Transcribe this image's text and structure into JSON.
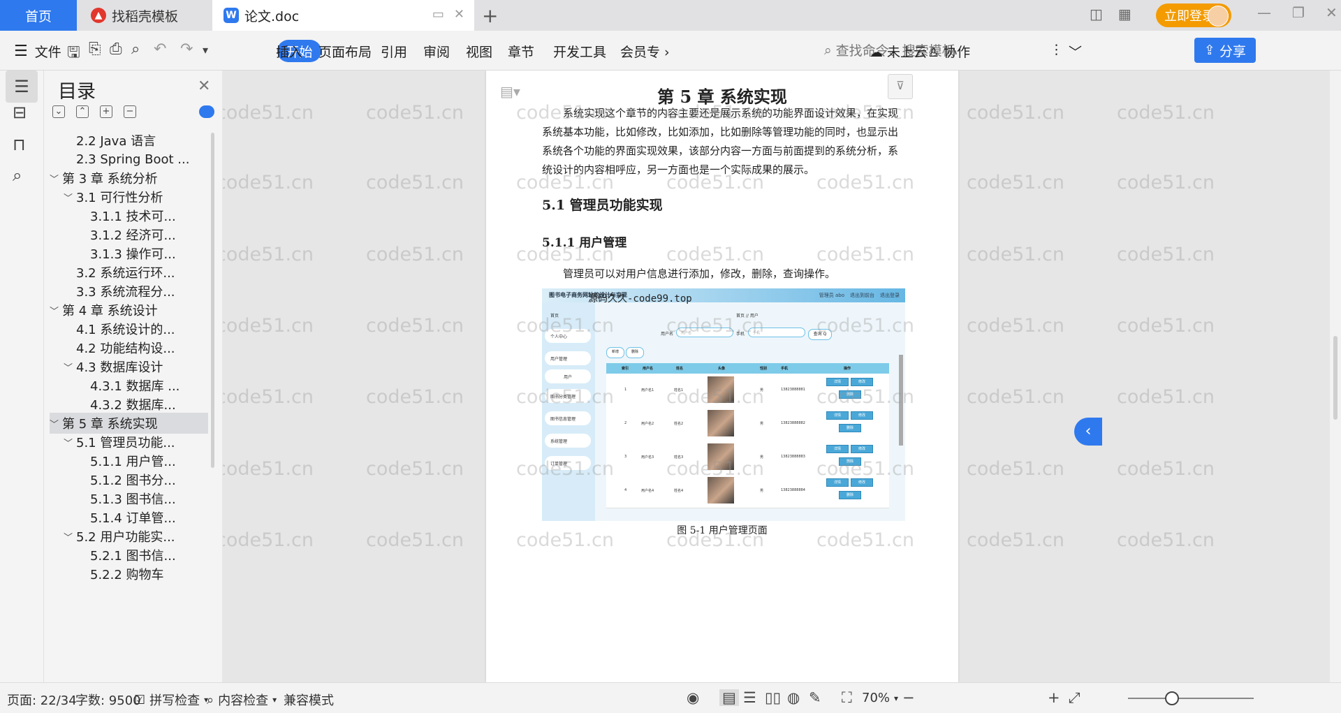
{
  "tabs": {
    "home": "首页",
    "template": "找稻壳模板",
    "doc": "论文.doc",
    "login": "立即登录"
  },
  "ribbon": {
    "file": "文件",
    "start": "开始",
    "insert": "插入",
    "layout": "页面布局",
    "reference": "引用",
    "review": "审阅",
    "view": "视图",
    "chapter": "章节",
    "devtools": "开发工具",
    "member": "会员专",
    "search_placeholder": "查找命令、搜索模板",
    "cloud": "未上云",
    "collab": "协作",
    "share": "分享"
  },
  "toc": {
    "title": "目录",
    "items": [
      {
        "label": "2.2 Java 语言",
        "level": 2,
        "chev": ""
      },
      {
        "label": "2.3 Spring Boot ...",
        "level": 2,
        "chev": ""
      },
      {
        "label": "第 3 章  系统分析",
        "level": 1,
        "chev": "﹀"
      },
      {
        "label": "3.1 可行性分析",
        "level": 2,
        "chev": "﹀"
      },
      {
        "label": "3.1.1 技术可...",
        "level": 3,
        "chev": ""
      },
      {
        "label": "3.1.2 经济可...",
        "level": 3,
        "chev": ""
      },
      {
        "label": "3.1.3 操作可...",
        "level": 3,
        "chev": ""
      },
      {
        "label": "3.2 系统运行环...",
        "level": 2,
        "chev": ""
      },
      {
        "label": "3.3 系统流程分...",
        "level": 2,
        "chev": ""
      },
      {
        "label": "第 4 章  系统设计",
        "level": 1,
        "chev": "﹀"
      },
      {
        "label": "4.1  系统设计的...",
        "level": 2,
        "chev": ""
      },
      {
        "label": "4.2  功能结构设...",
        "level": 2,
        "chev": ""
      },
      {
        "label": "4.3  数据库设计",
        "level": 2,
        "chev": "﹀"
      },
      {
        "label": "4.3.1  数据库 ...",
        "level": 3,
        "chev": ""
      },
      {
        "label": "4.3.2  数据库...",
        "level": 3,
        "chev": ""
      },
      {
        "label": "第 5 章  系统实现",
        "level": 1,
        "chev": "﹀"
      },
      {
        "label": "5.1 管理员功能...",
        "level": 2,
        "chev": "﹀"
      },
      {
        "label": "5.1.1  用户管...",
        "level": 3,
        "chev": ""
      },
      {
        "label": "5.1.2  图书分...",
        "level": 3,
        "chev": ""
      },
      {
        "label": "5.1.3  图书信...",
        "level": 3,
        "chev": ""
      },
      {
        "label": "5.1.4  订单管...",
        "level": 3,
        "chev": ""
      },
      {
        "label": "5.2  用户功能实...",
        "level": 2,
        "chev": "﹀"
      },
      {
        "label": "5.2.1  图书信...",
        "level": 3,
        "chev": ""
      },
      {
        "label": "5.2.2  购物车",
        "level": 3,
        "chev": ""
      }
    ]
  },
  "doc": {
    "chapter_title": "第 5 章  系统实现",
    "intro": "系统实现这个章节的内容主要还是展示系统的功能界面设计效果，在实现系统基本功能，比如修改，比如添加，比如删除等管理功能的同时，也显示出系统各个功能的界面实现效果，该部分内容一方面与前面提到的系统分析，系统设计的内容相呼应，另一方面也是一个实际成果的展示。",
    "sec51": "5.1 管理员功能实现",
    "sec511": "5.1.1  用户管理",
    "admin_line": "管理员可以对用户信息进行添加，修改，删除，查询操作。",
    "caption": "图 5-1  用户管理页面",
    "screenshot": {
      "title": "图书电子商务网站的设计与实现",
      "watermark": "源码久久-code99.top",
      "links": [
        "管理员 abo",
        "退出到前台",
        "退出登录"
      ],
      "menu": [
        "首页",
        "个人中心",
        "用户管理",
        "用户",
        "图书分类管理",
        "图书信息管理",
        "系统管理",
        "订单管理"
      ],
      "breadcrumb": "首页  //  用户",
      "f_username": "用户名",
      "f_phone": "手机",
      "ph_username": "用户名",
      "ph_phone": "手机",
      "query": "查询 Q",
      "add": "新增",
      "del": "删除",
      "headers": [
        "索引",
        "用户名",
        "姓名",
        "头像",
        "性别",
        "手机",
        "操作"
      ],
      "rows": [
        {
          "idx": "1",
          "user": "用户名1",
          "name": "姓名1",
          "sex": "男",
          "phone": "13823888881"
        },
        {
          "idx": "2",
          "user": "用户名2",
          "name": "姓名2",
          "sex": "男",
          "phone": "13823888882"
        },
        {
          "idx": "3",
          "user": "用户名3",
          "name": "姓名3",
          "sex": "男",
          "phone": "13823888883"
        },
        {
          "idx": "4",
          "user": "用户名4",
          "name": "姓名4",
          "sex": "男",
          "phone": "13823888884"
        }
      ],
      "act_detail": "详情",
      "act_edit": "修改",
      "act_delete": "删除"
    }
  },
  "watermark": "code51.cn",
  "status": {
    "page": "页面: 22/34",
    "words": "字数: 9500",
    "spell": "拼写检查",
    "content": "内容检查",
    "compat": "兼容模式",
    "zoom": "70%"
  }
}
